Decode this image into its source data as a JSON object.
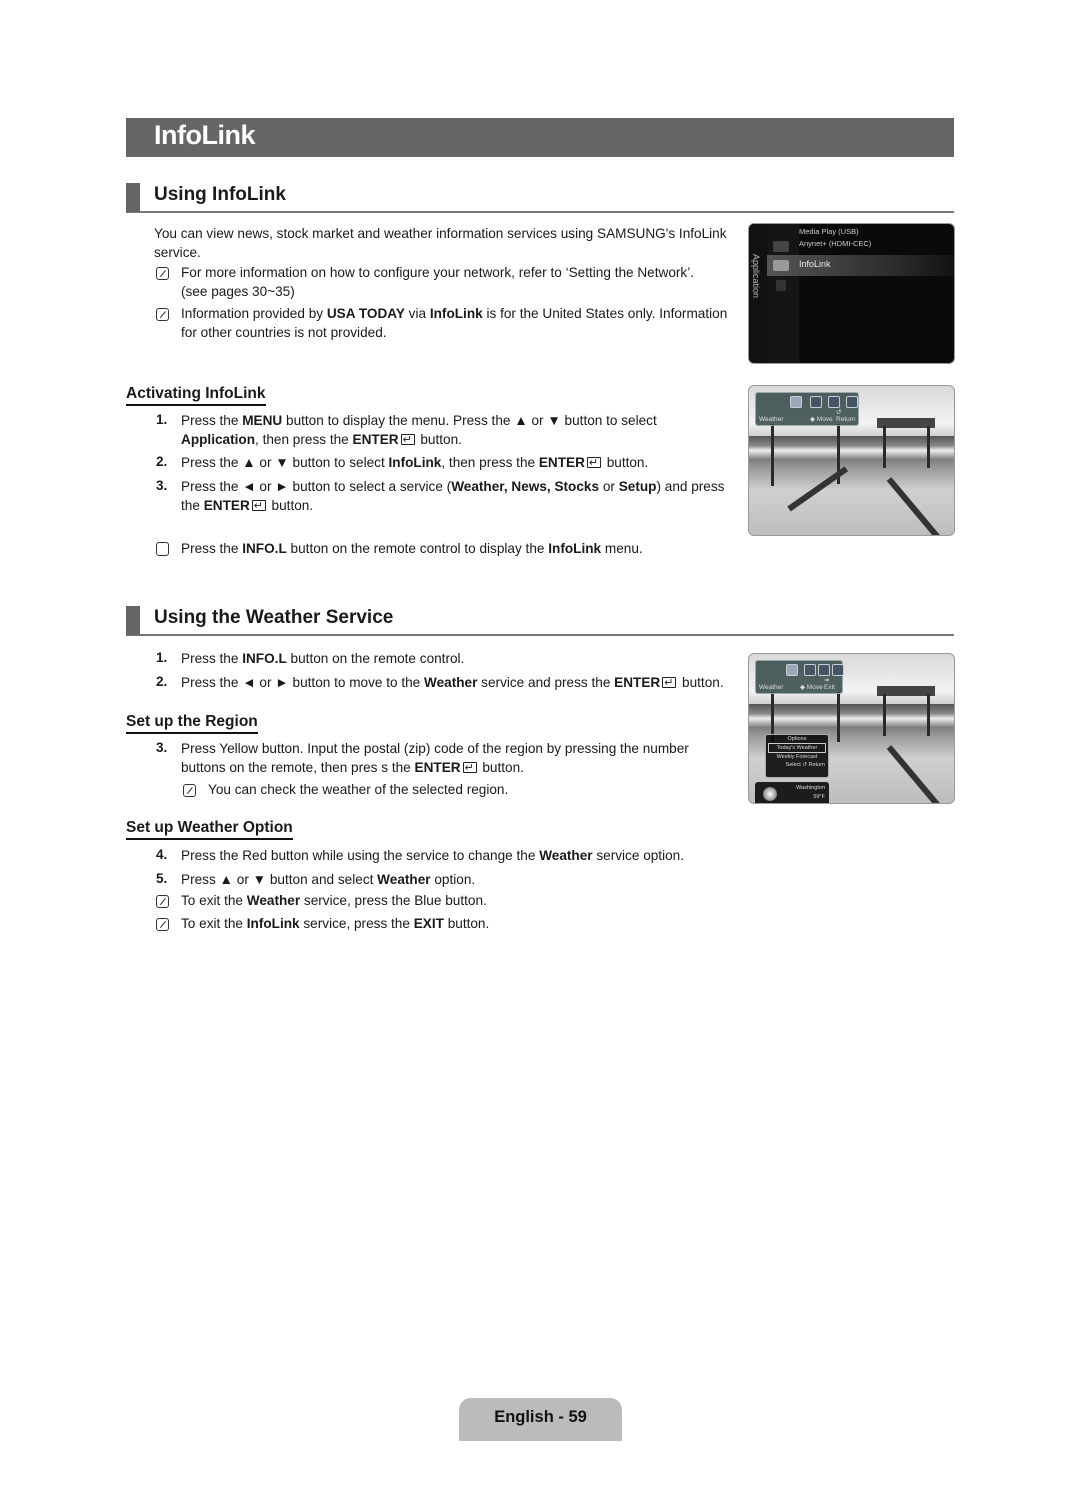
{
  "page_title": "InfoLink",
  "sections": {
    "using_infolink": {
      "heading": "Using InfoLink",
      "intro": "You can view news, stock market and weather information services using SAMSUNG's InfoLink service.",
      "note1_a": "For more information on how to configure your network, refer to ‘Setting the Network’.",
      "note1_b": "(see pages 30~35)",
      "note2_a_pre": "Information provided by ",
      "note2_a_b1": "USA TODAY",
      "note2_a_mid": " via ",
      "note2_a_b2": "InfoLink",
      "note2_a_post": " is for the United States only. Information",
      "note2_b": "for other countries is not provided."
    },
    "activating": {
      "heading": "Activating InfoLink",
      "steps": [
        {
          "num": "1.",
          "l1_pre": "Press the ",
          "l1_b": "MENU",
          "l1_post": " button to display the menu. Press the ▲ or ▼ button to select",
          "l2_b": "Application",
          "l2_mid": ", then press the ",
          "l2_b2": "ENTER",
          "l2_post": " button."
        },
        {
          "num": "2.",
          "pre": "Press the ▲ or ▼ button to select ",
          "b1": "InfoLink",
          "mid": ", then press the ",
          "b2": "ENTER",
          "post": " button."
        },
        {
          "num": "3.",
          "l1_pre": "Press the ◄ or ► button to select a service (",
          "l1_b": "Weather, News, Stocks",
          "l1_mid": " or ",
          "l1_b2": "Setup",
          "l1_post": ") and press",
          "l2_pre": "the ",
          "l2_b": "ENTER",
          "l2_post": " button."
        }
      ],
      "tip_pre": "Press the ",
      "tip_b1": "INFO.L",
      "tip_mid": " button on the remote control to display the ",
      "tip_b2": "InfoLink",
      "tip_post": " menu."
    },
    "weather": {
      "heading": "Using the Weather Service",
      "steps": [
        {
          "num": "1.",
          "pre": "Press the ",
          "b": "INFO.L",
          "post": " button on the remote control."
        },
        {
          "num": "2.",
          "pre": "Press the ◄ or ► button to move to the ",
          "b": "Weather",
          "mid": " service and press the ",
          "b2": "ENTER",
          "post": " button."
        }
      ]
    },
    "region": {
      "heading": "Set up the Region",
      "step_num": "3.",
      "l1": "Press Yellow button. Input the postal (zip) code of the region by pressing the number",
      "l2_pre": "buttons on the remote, then pres s the ",
      "l2_b": "ENTER",
      "l2_post": " button.",
      "note": "You can check the weather of the selected region."
    },
    "option": {
      "heading": "Set up Weather Option",
      "step4_num": "4.",
      "step4_pre": "Press the Red button while using the service to change the ",
      "step4_b": "Weather",
      "step4_post": " service option.",
      "step5_num": "5.",
      "step5_pre": "Press ▲ or ▼ button and select ",
      "step5_b": "Weather",
      "step5_post": " option.",
      "note1_pre": "To exit the ",
      "note1_b": "Weather",
      "note1_post": " service, press the Blue button.",
      "note2_pre": "To exit the ",
      "note2_b": "InfoLink",
      "note2_mid": " service, press the ",
      "note2_b2": "EXIT",
      "note2_post": " button."
    }
  },
  "screens": {
    "menu": {
      "side_label": "Application",
      "items": [
        "Media Play (USB)",
        "Anynet+ (HDMI-CEC)",
        "InfoLink"
      ]
    },
    "services_bar": {
      "label": "Weather",
      "move": "◆ Move",
      "return": "↺ Return",
      "exit": "➔ Exit"
    },
    "options_popup": {
      "title": "Options",
      "items": [
        "Today's Weather",
        "Weekly Forecast"
      ],
      "footer": "Select ↺ Return"
    },
    "weather_info": {
      "city": "Washington",
      "temp": "59°F"
    }
  },
  "footer": {
    "page_label": "English - 59"
  }
}
